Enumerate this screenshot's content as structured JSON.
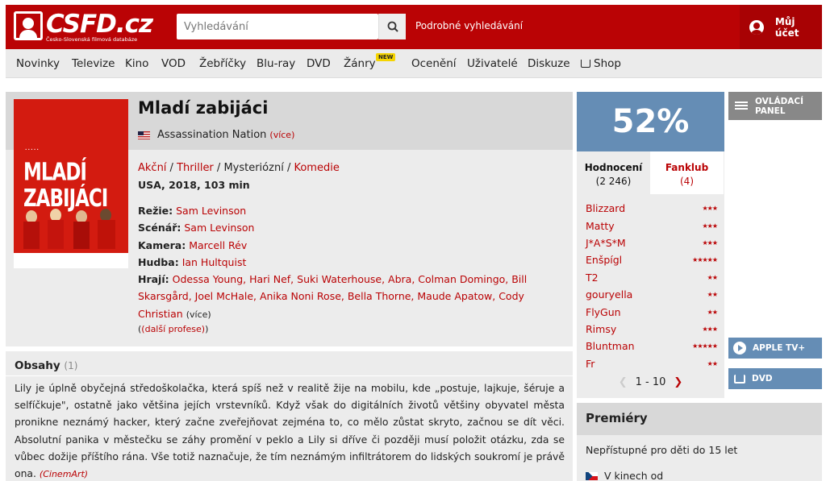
{
  "header": {
    "logo_text": "CSFD.cz",
    "logo_subtitle": "Česko-Slovenská filmová databáze",
    "search_placeholder": "Vyhledávání",
    "advanced_search": "Podrobné vyhledávání",
    "account": "Můj účet"
  },
  "nav": {
    "items": [
      "Novinky",
      "Televize",
      "Kino",
      "VOD",
      "Žebříčky",
      "Blu-ray",
      "DVD",
      "Žánry",
      "Ocenění",
      "Uživatelé",
      "Diskuze",
      "Shop"
    ],
    "new_badge": "NEW"
  },
  "film": {
    "poster_text": "MLADÍ ZABIJÁCI",
    "title": "Mladí zabijáci",
    "original_title": "Assassination Nation",
    "original_more": "(více)",
    "genres": [
      "Akční",
      "Thriller",
      "Mysteriózní",
      "Komedie"
    ],
    "origin": "USA, 2018, 103 min",
    "credits": {
      "directing_label": "Režie:",
      "directing": "Sam Levinson",
      "writing_label": "Scénář:",
      "writing": "Sam Levinson",
      "camera_label": "Kamera:",
      "camera": "Marcell Rév",
      "music_label": "Hudba:",
      "music": "Ian Hultquist",
      "cast_label": "Hrají:",
      "cast": "Odessa Young, Hari Nef, Suki Waterhouse, Abra, Colman Domingo, Bill Skarsgård, Joel McHale, Anika Noni Rose, Bella Thorne, Maude Apatow, Cody Christian",
      "cast_more": "(více)"
    },
    "more_professions": "(další profese)"
  },
  "plot": {
    "heading": "Obsahy",
    "count": "(1)",
    "text": "Lily je úplně obyčejná středoškolačka, která spíš než v realitě žije na mobilu, kde „postuje, lajkuje, šéruje a selfíčkuje\", ostatně jako většina jejích vrstevníků. Když však do digitálních životů většiny obyvatel města pronikne neznámý hacker, který začne zveřejňovat zejména to, co mělo zůstat skryto, začnou se dít věci. Absolutní panika v městečku se záhy promění v peklo a Lily si dříve či později musí položit otázku, zda se vůbec dožije příštího rána. Vše totiž naznačuje, že tím neznámým infiltrátorem do lidských soukromí je právě ona.",
    "source": "(CinemArt)"
  },
  "rating": {
    "percent": "52%",
    "tab_ratings": "Hodnocení",
    "tab_ratings_count": "(2 246)",
    "tab_fanclub": "Fanklub",
    "tab_fanclub_count": "(4)",
    "users": [
      {
        "name": "Blizzard",
        "stars": 3
      },
      {
        "name": "Matty",
        "stars": 3
      },
      {
        "name": "J*A*S*M",
        "stars": 3
      },
      {
        "name": "Enšpígl",
        "stars": 5
      },
      {
        "name": "T2",
        "stars": 2
      },
      {
        "name": "gouryella",
        "stars": 2
      },
      {
        "name": "FlyGun",
        "stars": 2
      },
      {
        "name": "Rimsy",
        "stars": 3
      },
      {
        "name": "Bluntman",
        "stars": 5
      },
      {
        "name": "Fr",
        "stars": 2
      }
    ],
    "pager": "1 - 10"
  },
  "side": {
    "panel": "OVLÁDACÍ PANEL",
    "apple": "APPLE TV+",
    "dvd": "DVD"
  },
  "premiery": {
    "heading": "Premiéry",
    "age": "Nepřístupné pro děti do 15 let",
    "cinema": "V kinech od"
  },
  "colors": {
    "brand_red": "#ba0305",
    "rating_blue": "#658db5"
  }
}
